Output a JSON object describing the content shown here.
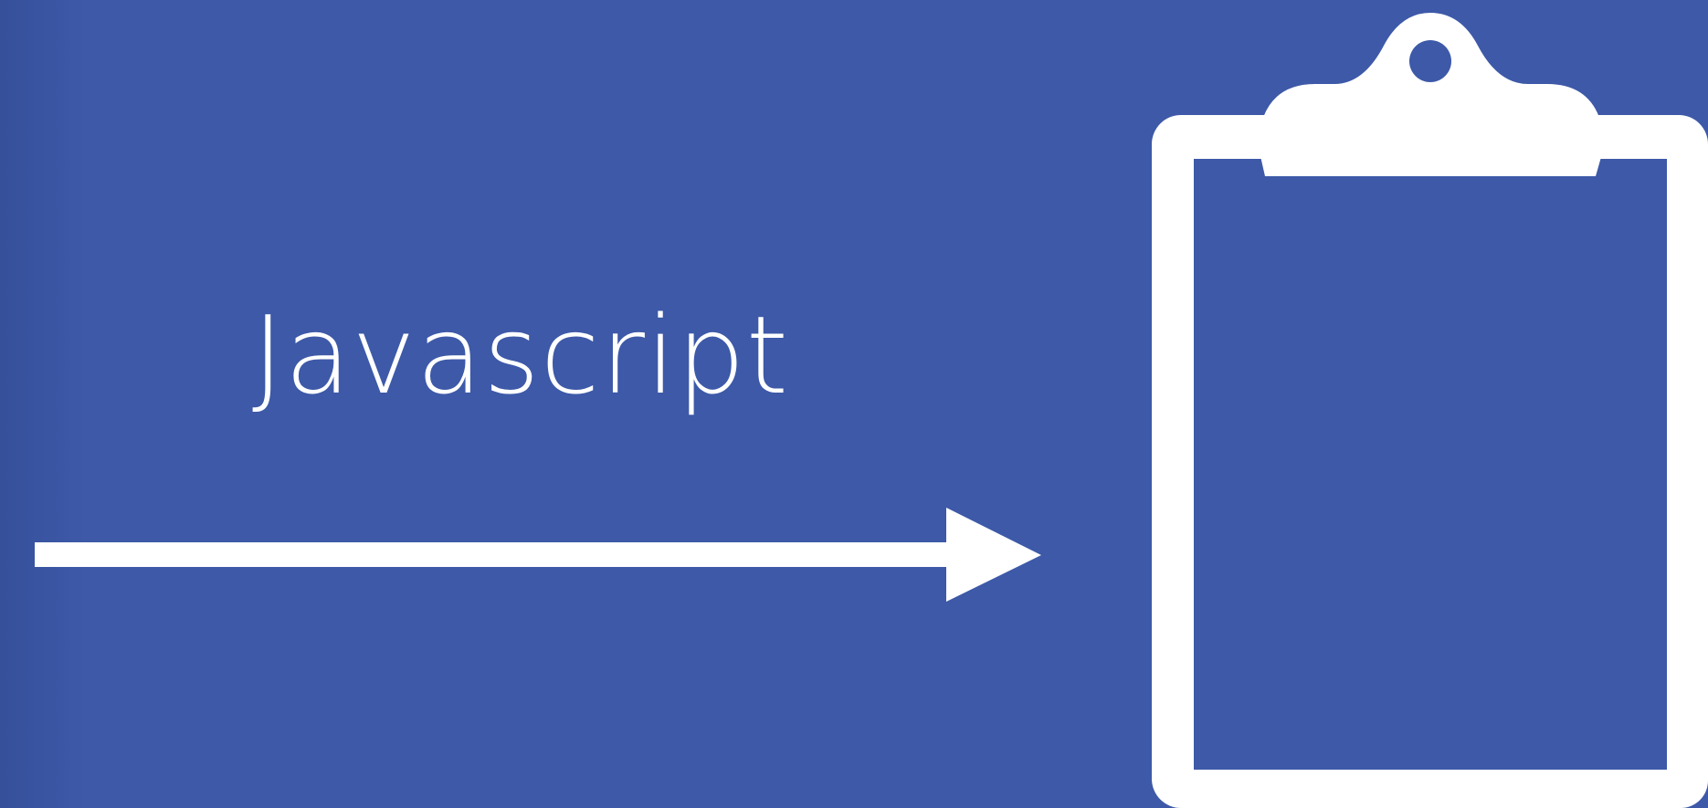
{
  "colors": {
    "background": "#3d59a8",
    "background_edge": "#36509a",
    "foreground": "#ffffff"
  },
  "diagram": {
    "label": "Javascript",
    "arrow": {
      "icon": "right-arrow-icon"
    },
    "target": {
      "icon": "clipboard-icon"
    }
  }
}
